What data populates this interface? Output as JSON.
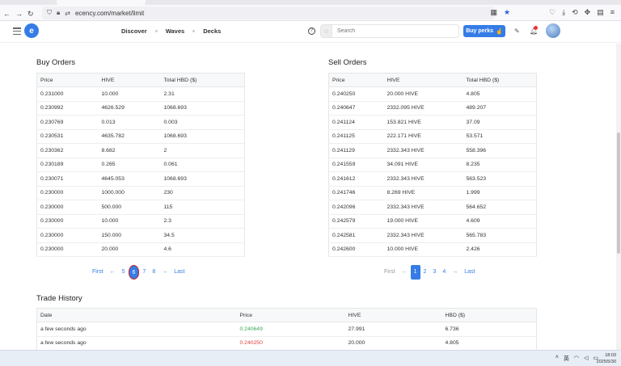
{
  "browser": {
    "url": "ecency.com/market/limit"
  },
  "header": {
    "nav": [
      "Discover",
      "Waves",
      "Decks"
    ],
    "search_placeholder": "Search",
    "perks_label": "Buy perks"
  },
  "buy_orders": {
    "title": "Buy Orders",
    "columns": [
      "Price",
      "HIVE",
      "Total HBD ($)"
    ],
    "rows": [
      [
        "0.231000",
        "10.000",
        "2.31"
      ],
      [
        "0.230992",
        "4626.529",
        "1068.693"
      ],
      [
        "0.230769",
        "0.013",
        "0.003"
      ],
      [
        "0.230531",
        "4635.782",
        "1068.693"
      ],
      [
        "0.230362",
        "8.682",
        "2"
      ],
      [
        "0.230189",
        "0.265",
        "0.061"
      ],
      [
        "0.230071",
        "4645.053",
        "1068.693"
      ],
      [
        "0.230000",
        "1000.000",
        "230"
      ],
      [
        "0.230000",
        "500.000",
        "115"
      ],
      [
        "0.230000",
        "10.000",
        "2.3"
      ],
      [
        "0.230000",
        "150.000",
        "34.5"
      ],
      [
        "0.230000",
        "20.000",
        "4.6"
      ]
    ],
    "pager": {
      "first": "First",
      "prev": "←",
      "pages": [
        "5",
        "6",
        "7",
        "8"
      ],
      "active": "6",
      "next": "→",
      "last": "Last"
    }
  },
  "sell_orders": {
    "title": "Sell Orders",
    "columns": [
      "Price",
      "HIVE",
      "Total HBD ($)"
    ],
    "rows": [
      [
        "0.240250",
        "20.000 HIVE",
        "4.805"
      ],
      [
        "0.240647",
        "2332.095 HIVE",
        "489.207"
      ],
      [
        "0.241124",
        "153.821 HIVE",
        "37.09"
      ],
      [
        "0.241125",
        "222.171 HIVE",
        "53.571"
      ],
      [
        "0.241129",
        "2332.343 HIVE",
        "558.396"
      ],
      [
        "0.241559",
        "34.091 HIVE",
        "8.235"
      ],
      [
        "0.241612",
        "2332.343 HIVE",
        "563.523"
      ],
      [
        "0.241746",
        "8.269 HIVE",
        "1.999"
      ],
      [
        "0.242096",
        "2332.343 HIVE",
        "564.652"
      ],
      [
        "0.242579",
        "19.000 HIVE",
        "4.609"
      ],
      [
        "0.242581",
        "2332.343 HIVE",
        "565.783"
      ],
      [
        "0.242600",
        "10.000 HIVE",
        "2.426"
      ]
    ],
    "pager": {
      "first": "First",
      "prev": "←",
      "pages": [
        "1",
        "2",
        "3",
        "4"
      ],
      "active": "1",
      "next": "→",
      "last": "Last"
    }
  },
  "trade_history": {
    "title": "Trade History",
    "columns": [
      "Date",
      "Price",
      "HIVE",
      "HBD ($)"
    ],
    "rows": [
      {
        "date": "a few seconds ago",
        "price": "0.240649",
        "hive": "27.991",
        "hbd": "6.736",
        "side": "buy"
      },
      {
        "date": "a few seconds ago",
        "price": "0.240250",
        "hive": "20.000",
        "hbd": "4.805",
        "side": "sell"
      }
    ]
  },
  "taskbar": {
    "ime": "英",
    "time": "18:03",
    "date": "2025/5/30"
  },
  "colors": {
    "accent": "#357ce6",
    "buy": "#3aa855",
    "sell": "#d94040",
    "annotation": "#e02424"
  }
}
